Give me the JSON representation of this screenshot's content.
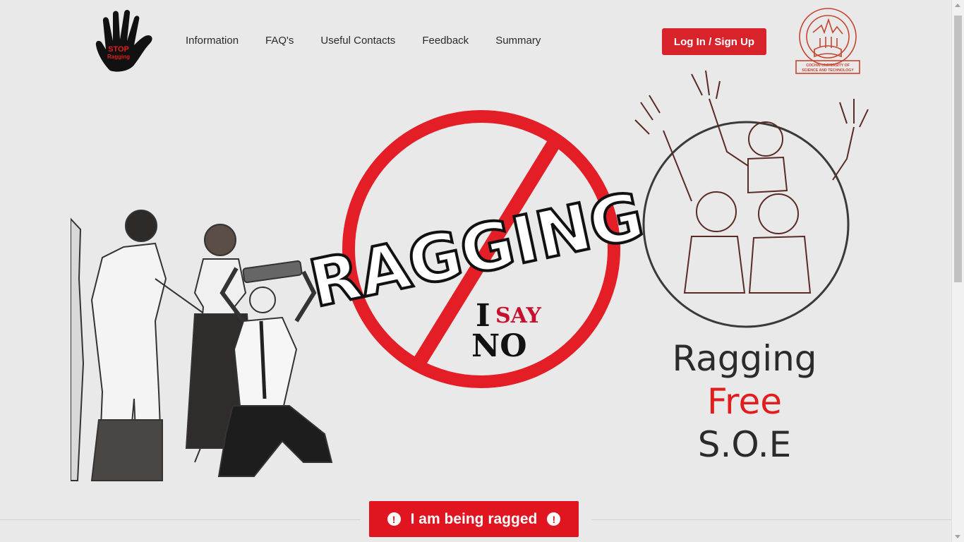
{
  "logo": {
    "text_line1": "STOP",
    "text_line2": "Ragging",
    "icon": "hand-icon"
  },
  "nav": {
    "items": [
      {
        "label": "Information"
      },
      {
        "label": "FAQ's"
      },
      {
        "label": "Useful Contacts"
      },
      {
        "label": "Feedback"
      },
      {
        "label": "Summary"
      }
    ]
  },
  "header": {
    "login_label": "Log In / Sign Up"
  },
  "cusat_logo": {
    "caption_line1": "COCHIN UNIVERSITY OF",
    "caption_line2": "SCIENCE AND TECHNOLOGY"
  },
  "hero": {
    "ragging_word": "RAGGING",
    "slogan_i": "I",
    "slogan_say": "SAY",
    "slogan_no": "NO"
  },
  "tagline": {
    "line1": "Ragging",
    "line2": "Free",
    "line3": "S.O.E"
  },
  "alert": {
    "label": "I am being ragged",
    "icon": "exclamation-circle-icon",
    "icon_glyph": "!"
  },
  "colors": {
    "accent": "#d8232a",
    "alert": "#e0151f",
    "tagline_red": "#e11d1d",
    "background": "#e9e9e9"
  }
}
